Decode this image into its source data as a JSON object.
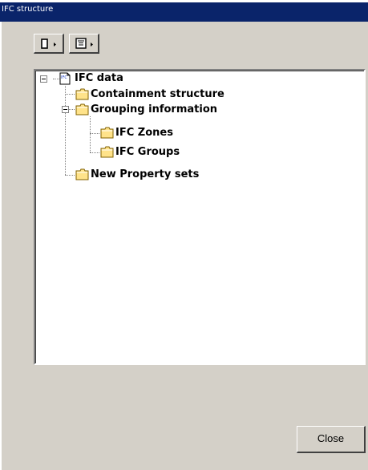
{
  "window": {
    "title": "IFC structure"
  },
  "toolbar": {
    "buttons": [
      {
        "icon": "rectangle-dropdown-icon"
      },
      {
        "icon": "list-view-dropdown-icon"
      }
    ]
  },
  "tree": {
    "root": {
      "label": "IFC data",
      "icon": "ifc-document-icon",
      "expanded": true,
      "children": [
        {
          "label": "Containment structure",
          "icon": "folder-icon"
        },
        {
          "label": "Grouping information",
          "icon": "folder-icon",
          "expanded": true,
          "children": [
            {
              "label": "IFC Zones",
              "icon": "folder-icon"
            },
            {
              "label": "IFC Groups",
              "icon": "folder-icon"
            }
          ]
        },
        {
          "label": "New Property sets",
          "icon": "folder-icon"
        }
      ]
    }
  },
  "footer": {
    "close_label": "Close"
  },
  "colors": {
    "title_bar": "#0a246a",
    "window_bg": "#d4d0c8",
    "tree_bg": "#ffffff",
    "folder": "#ffe38a"
  }
}
